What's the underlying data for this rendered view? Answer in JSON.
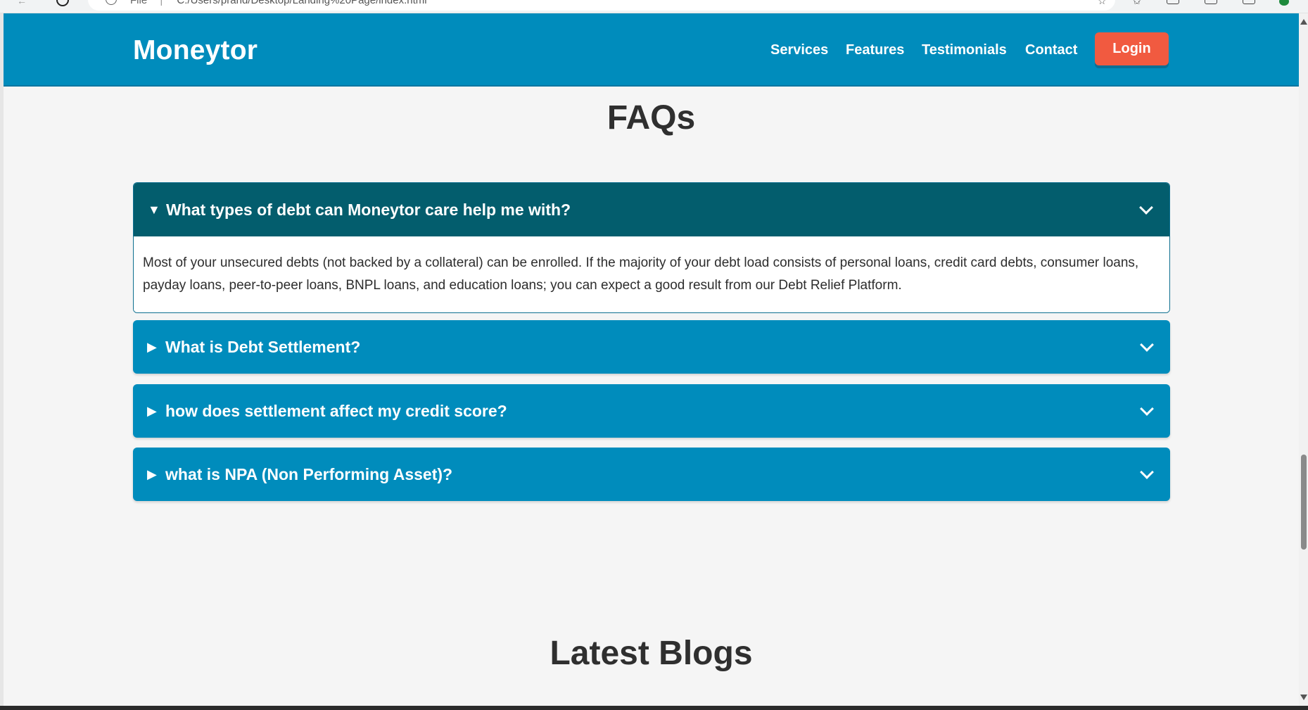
{
  "browser": {
    "url_scheme": "File",
    "url_path": "C:/Users/prand/Desktop/Landing%20Page/index.html"
  },
  "header": {
    "logo": "Moneytor",
    "nav": [
      {
        "label": "Services"
      },
      {
        "label": "Features"
      },
      {
        "label": "Testimonials"
      },
      {
        "label": "Contact"
      }
    ],
    "login_label": "Login"
  },
  "faq": {
    "title": "FAQs",
    "items": [
      {
        "question": "What types of debt can Moneytor care help me with?",
        "open": true,
        "answer": "Most of your unsecured debts (not backed by a collateral) can be enrolled. If the majority of your debt load consists of personal loans, credit card debts, consumer loans, payday loans, peer-to-peer loans, BNPL loans, and education loans; you can expect a good result from our Debt Relief Platform."
      },
      {
        "question": "What is Debt Settlement?",
        "open": false
      },
      {
        "question": "how does settlement affect my credit score?",
        "open": false
      },
      {
        "question": "what is NPA (Non Performing Asset)?",
        "open": false
      }
    ],
    "open_marker": "▼",
    "closed_marker": "▶"
  },
  "blogs": {
    "title": "Latest Blogs"
  },
  "colors": {
    "header_bg": "#008cbc",
    "login_bg": "#f15a40",
    "faq_open_head": "#035d6d",
    "faq_closed_bg": "#008cbc",
    "page_bg": "#f5f5f5"
  }
}
